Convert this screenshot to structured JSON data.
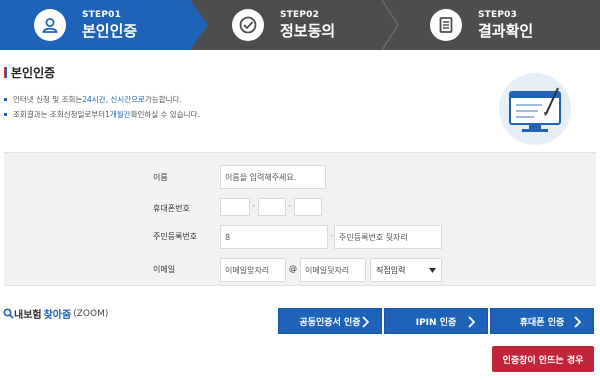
{
  "steps": [
    {
      "no": "STEP01",
      "title": "본인인증",
      "icon": "user-icon",
      "active": true
    },
    {
      "no": "STEP02",
      "title": "정보동의",
      "icon": "check-circle-icon",
      "active": false
    },
    {
      "no": "STEP03",
      "title": "결과확인",
      "icon": "document-icon",
      "active": false
    }
  ],
  "section": {
    "title": "본인인증"
  },
  "notes": {
    "line1_pre": "인터넷 신청 및 조회는 ",
    "line1_hl": "24시간, 신시간으로",
    "line1_post": " 가능합니다.",
    "line2_pre": "조회결과는 조회신청일로부터 ",
    "line2_hl": "1개월간",
    "line2_post": " 확인하실 수 있습니다."
  },
  "form": {
    "name_label": "이름",
    "name_placeholder": "이름을 입력해주세요.",
    "phone_label": "휴대폰번호",
    "phone_sep": "-",
    "rrn_label": "주민등록번호",
    "rrn_front_value": "8",
    "rrn_back_placeholder": "주민등록번호 뒷자리",
    "email_label": "이메일",
    "email_local_placeholder": "이메일앞자리",
    "email_at": "@",
    "email_domain_placeholder": "이메일뒷자리",
    "email_select_value": "직접입력"
  },
  "zoom": {
    "pre": "내보험",
    "strong": "찾아줌",
    "suffix": "(ZOOM)"
  },
  "buttons": {
    "cert": "공동인증서 인증",
    "ipin": "IPIN 인증",
    "phone": "휴대폰 인증",
    "popup_help": "인증창이 안뜨는 경우"
  },
  "colors": {
    "primary": "#1e63b8",
    "dark": "#4d4d4d",
    "danger": "#c0253a"
  }
}
